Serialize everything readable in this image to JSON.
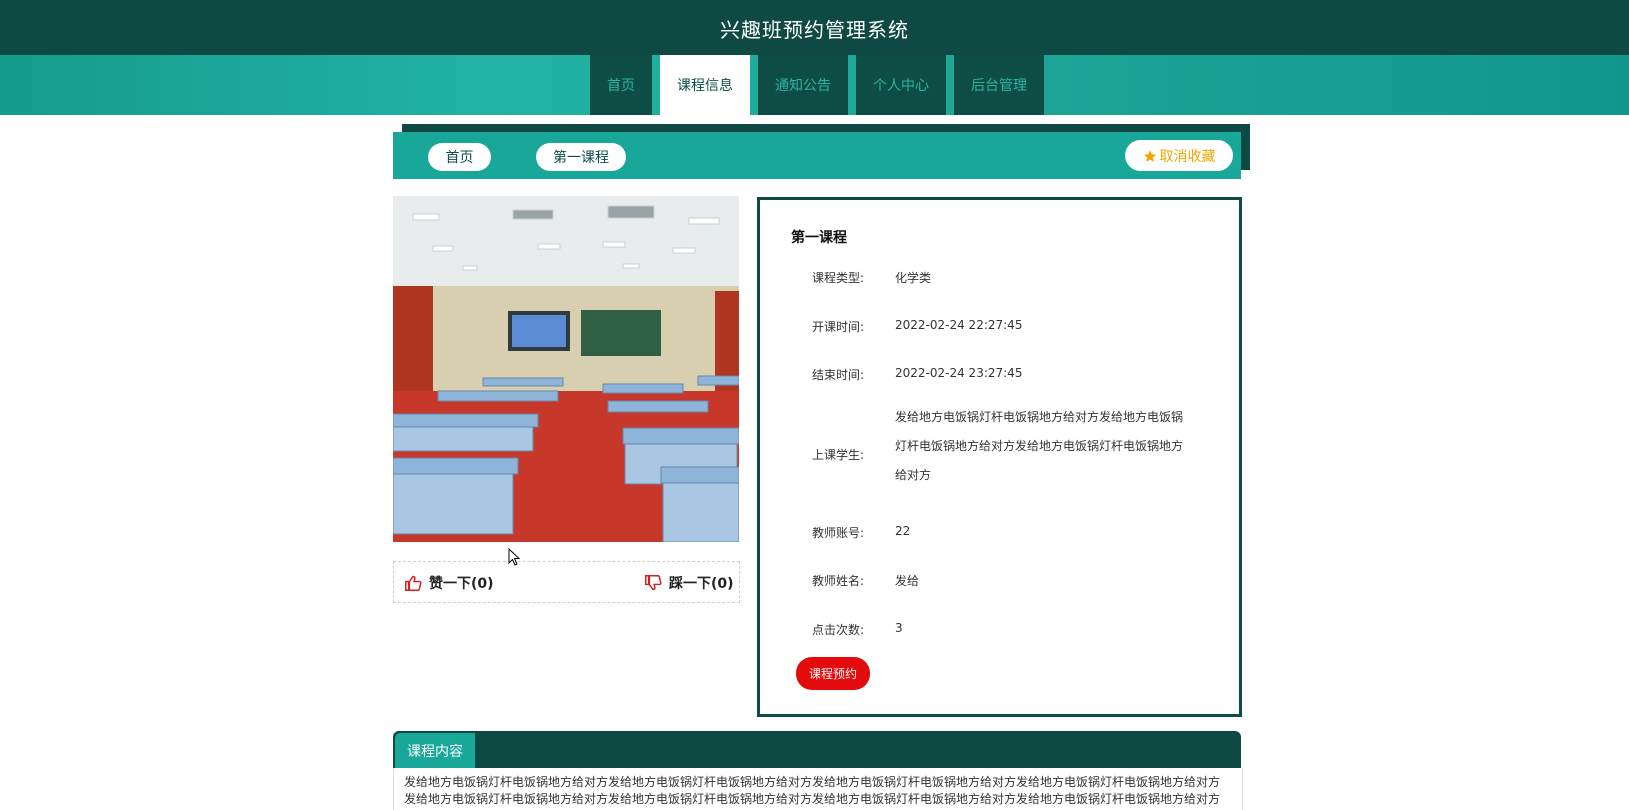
{
  "header": {
    "title": "兴趣班预约管理系统"
  },
  "nav": [
    {
      "label": "首页",
      "active": false
    },
    {
      "label": "课程信息",
      "active": true
    },
    {
      "label": "通知公告",
      "active": false
    },
    {
      "label": "个人中心",
      "active": false
    },
    {
      "label": "后台管理",
      "active": false
    }
  ],
  "breadcrumb": {
    "home": "首页",
    "current": "第一课程"
  },
  "favorite": {
    "label": "取消收藏",
    "icon": "star-icon"
  },
  "likes": {
    "up_label": "赞一下(0)",
    "down_label": "踩一下(0)"
  },
  "detail": {
    "name": "第一课程",
    "type_label": "课程类型:",
    "type_value": "化学类",
    "start_label": "开课时间:",
    "start_value": "2022-02-24 22:27:45",
    "end_label": "结束时间:",
    "end_value": "2022-02-24 23:27:45",
    "students_label": "上课学生:",
    "students_value": "发给地方电饭锅灯杆电饭锅地方给对方发给地方电饭锅灯杆电饭锅地方给对方发给地方电饭锅灯杆电饭锅地方给对方",
    "teacher_account_label": "教师账号:",
    "teacher_account_value": "22",
    "teacher_name_label": "教师姓名:",
    "teacher_name_value": "发给",
    "clicks_label": "点击次数:",
    "clicks_value": "3",
    "book_label": "课程预约"
  },
  "content": {
    "tab": "课程内容",
    "line1": "发给地方电饭锅灯杆电饭锅地方给对方发给地方电饭锅灯杆电饭锅地方给对方发给地方电饭锅灯杆电饭锅地方给对方发给地方电饭锅灯杆电饭锅地方给对方",
    "line2": "发给地方电饭锅灯杆电饭锅地方给对方发给地方电饭锅灯杆电饭锅地方给对方发给地方电饭锅灯杆电饭锅地方给对方发给地方电饭锅灯杆电饭锅地方给对方"
  },
  "colors": {
    "header_bg": "#0e4a43",
    "accent": "#18a799",
    "book_button": "#e30b0b",
    "favorite": "#f0a800"
  }
}
